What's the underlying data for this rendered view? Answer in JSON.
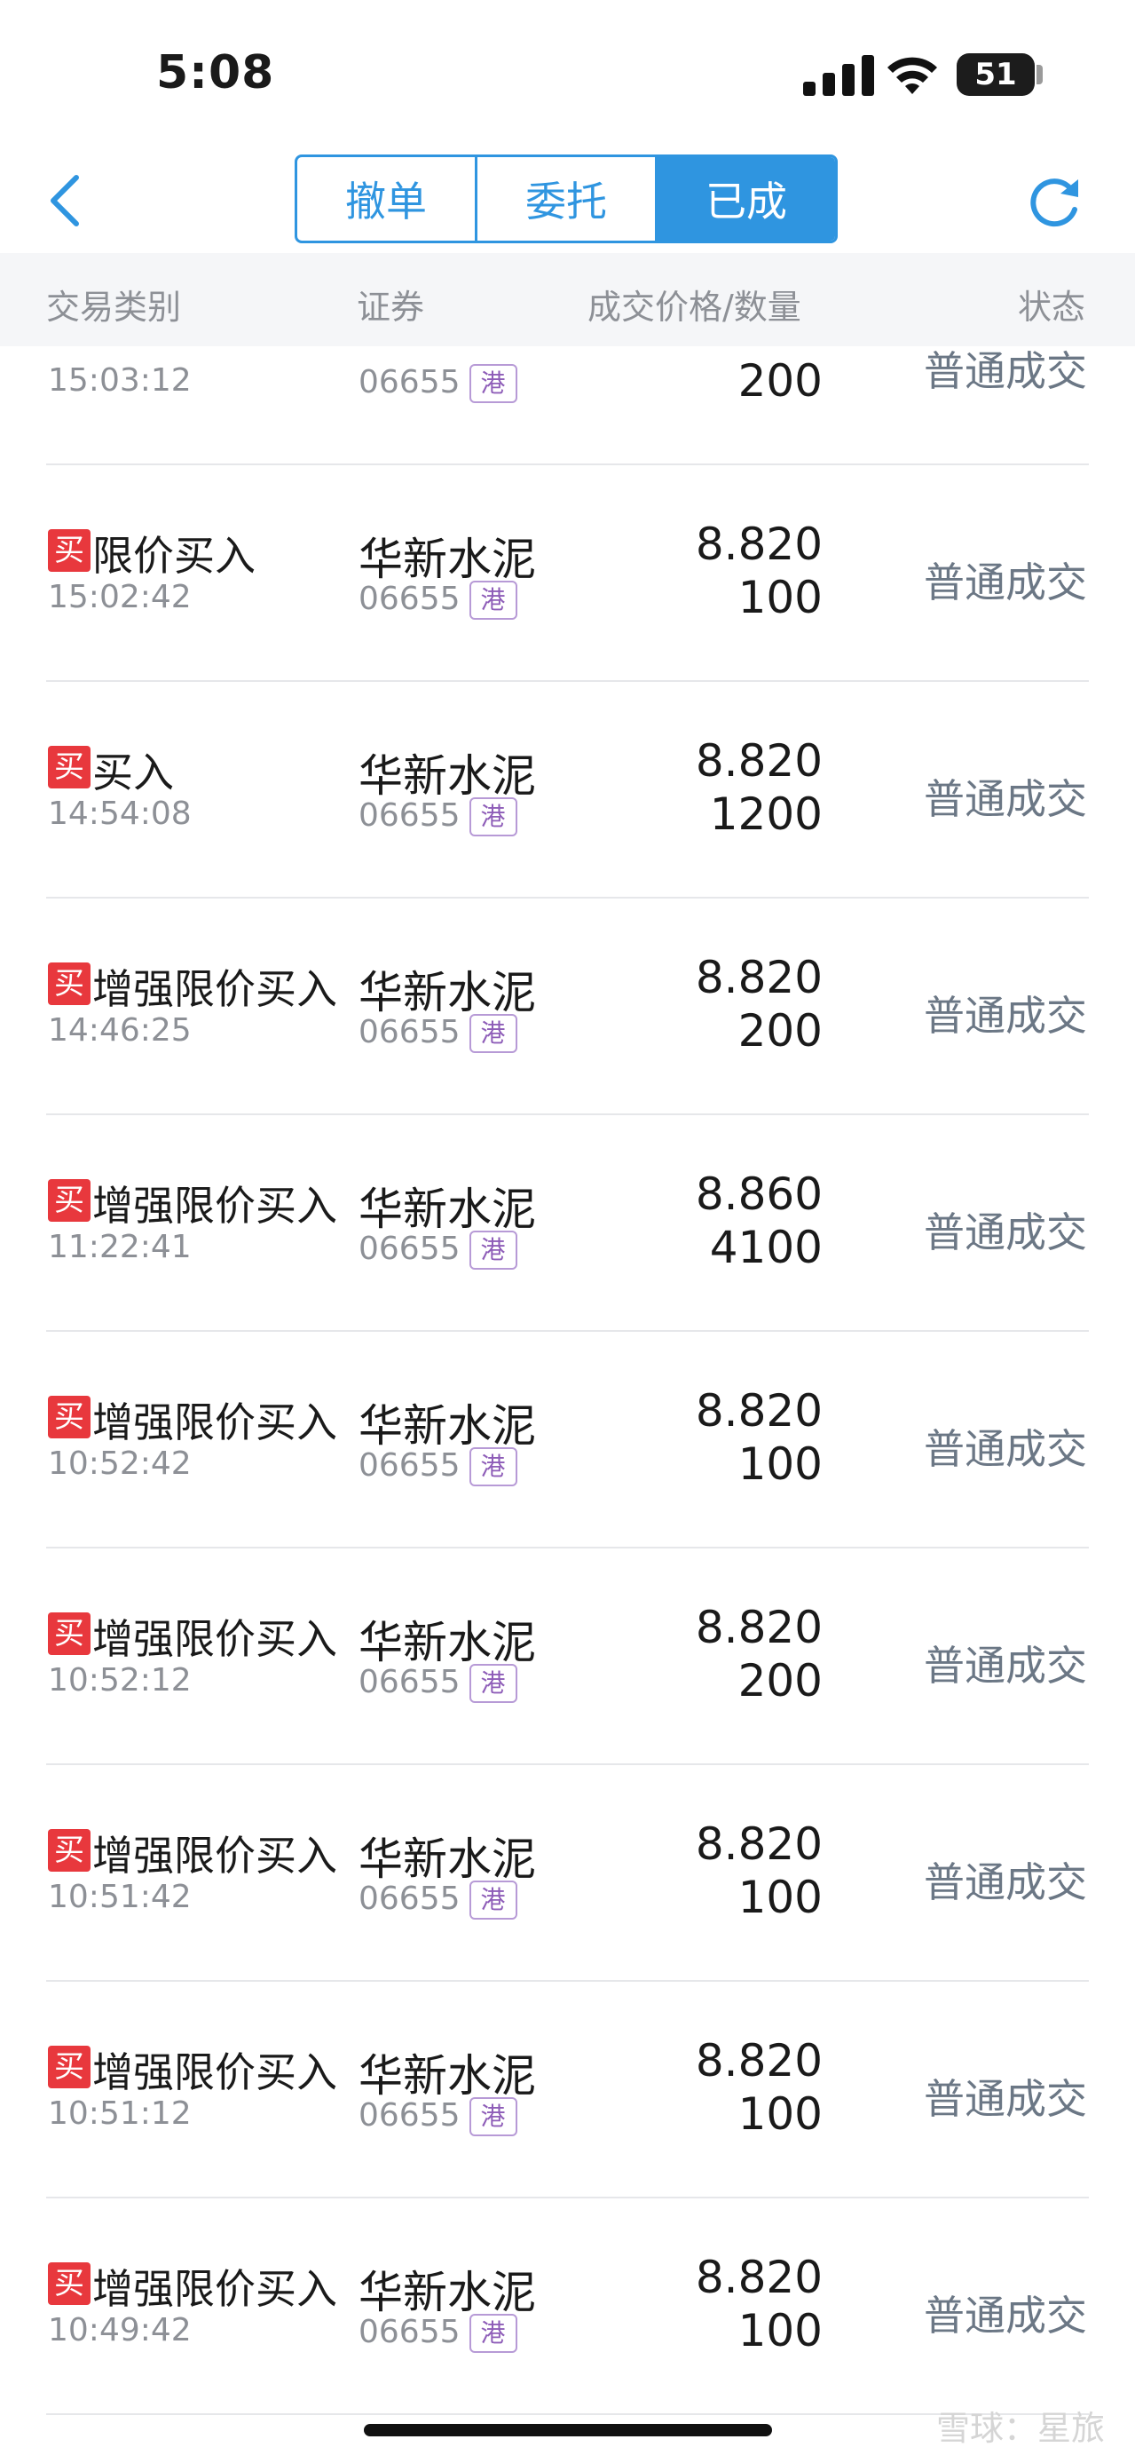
{
  "status_bar": {
    "time": "5:08",
    "battery": "51"
  },
  "tabs": [
    {
      "label": "撤单",
      "active": false
    },
    {
      "label": "委托",
      "active": false
    },
    {
      "label": "已成",
      "active": true
    }
  ],
  "columns": {
    "type": "交易类别",
    "security": "证券",
    "price_qty": "成交价格/数量",
    "status": "状态"
  },
  "partial_row": {
    "time": "15:03:12",
    "code": "06655",
    "market_tag": "港",
    "qty": "200",
    "status": "普通成交"
  },
  "rows": [
    {
      "badge": "买",
      "type": "限价买入",
      "time": "15:02:42",
      "name": "华新水泥",
      "code": "06655",
      "market_tag": "港",
      "price": "8.820",
      "qty": "100",
      "status": "普通成交"
    },
    {
      "badge": "买",
      "type": "买入",
      "time": "14:54:08",
      "name": "华新水泥",
      "code": "06655",
      "market_tag": "港",
      "price": "8.820",
      "qty": "1200",
      "status": "普通成交"
    },
    {
      "badge": "买",
      "type": "增强限价买入",
      "time": "14:46:25",
      "name": "华新水泥",
      "code": "06655",
      "market_tag": "港",
      "price": "8.820",
      "qty": "200",
      "status": "普通成交"
    },
    {
      "badge": "买",
      "type": "增强限价买入",
      "time": "11:22:41",
      "name": "华新水泥",
      "code": "06655",
      "market_tag": "港",
      "price": "8.860",
      "qty": "4100",
      "status": "普通成交"
    },
    {
      "badge": "买",
      "type": "增强限价买入",
      "time": "10:52:42",
      "name": "华新水泥",
      "code": "06655",
      "market_tag": "港",
      "price": "8.820",
      "qty": "100",
      "status": "普通成交"
    },
    {
      "badge": "买",
      "type": "增强限价买入",
      "time": "10:52:12",
      "name": "华新水泥",
      "code": "06655",
      "market_tag": "港",
      "price": "8.820",
      "qty": "200",
      "status": "普通成交"
    },
    {
      "badge": "买",
      "type": "增强限价买入",
      "time": "10:51:42",
      "name": "华新水泥",
      "code": "06655",
      "market_tag": "港",
      "price": "8.820",
      "qty": "100",
      "status": "普通成交"
    },
    {
      "badge": "买",
      "type": "增强限价买入",
      "time": "10:51:12",
      "name": "华新水泥",
      "code": "06655",
      "market_tag": "港",
      "price": "8.820",
      "qty": "100",
      "status": "普通成交"
    },
    {
      "badge": "买",
      "type": "增强限价买入",
      "time": "10:49:42",
      "name": "华新水泥",
      "code": "06655",
      "market_tag": "港",
      "price": "8.820",
      "qty": "100",
      "status": "普通成交"
    }
  ],
  "watermark": "雪球：星旅",
  "colors": {
    "accent": "#2f95e0",
    "buy_badge": "#e8383d",
    "status_text": "#6b7785"
  }
}
